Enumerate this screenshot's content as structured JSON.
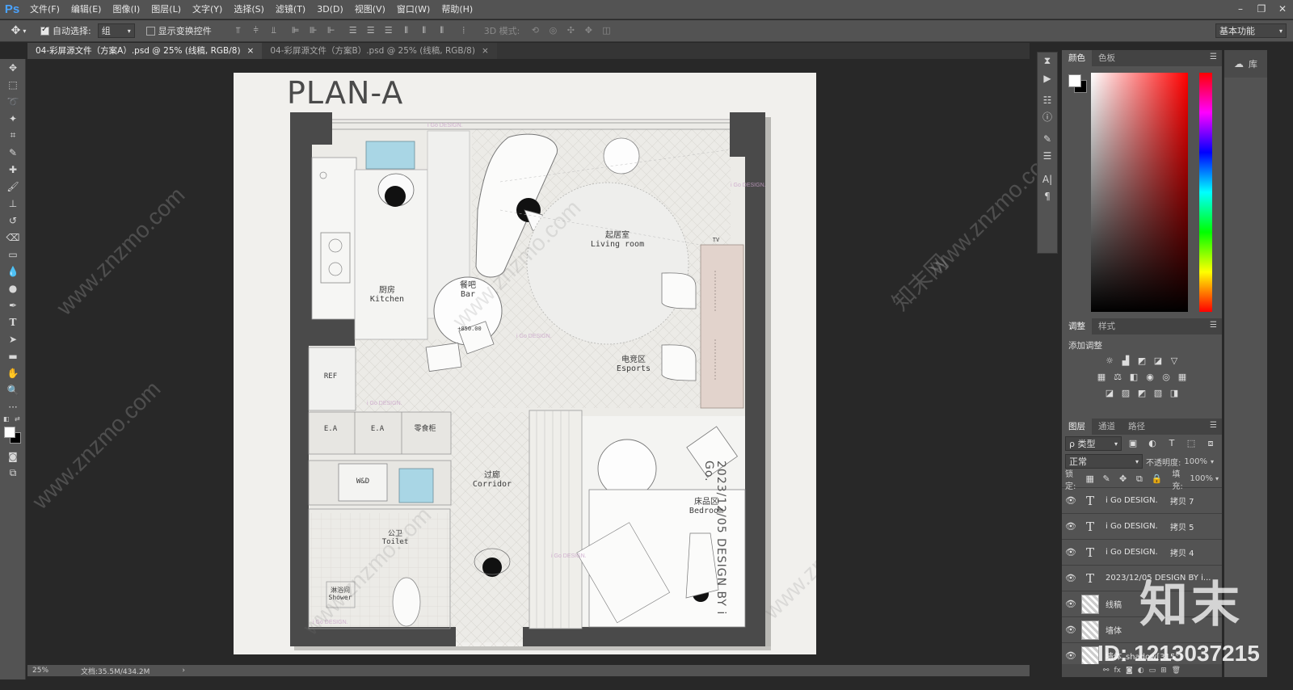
{
  "app": {
    "logo": "Ps"
  },
  "menu": [
    "文件(F)",
    "编辑(E)",
    "图像(I)",
    "图层(L)",
    "文字(Y)",
    "选择(S)",
    "滤镜(T)",
    "3D(D)",
    "视图(V)",
    "窗口(W)",
    "帮助(H)"
  ],
  "window_controls": [
    "–",
    "❐",
    "✕"
  ],
  "options": {
    "auto_select_label": "自动选择:",
    "auto_select_value": "组",
    "show_transform_label": "显示变换控件",
    "mode_3d_label": "3D 模式:",
    "workspace": "基本功能"
  },
  "tabs": [
    {
      "label": "04-彩屏源文件（方案A）.psd @ 25% (线稿, RGB/8)",
      "close": "×"
    },
    {
      "label": "04-彩屏源文件（方案B）.psd @ 25% (线稿, RGB/8)",
      "close": "×"
    }
  ],
  "status": {
    "zoom": "25%",
    "doc": "文档:35.5M/434.2M",
    "arrow": "›"
  },
  "plan": {
    "title": "PLAN-A",
    "date": "2023/12/05 DESIGN BY i Go.",
    "watermark": "i Go DESIGN.",
    "rooms": {
      "living_cn": "起居室",
      "living_en": "Living room",
      "kitchen_cn": "厨房",
      "kitchen_en": "Kitchen",
      "bar_cn": "餐吧",
      "bar_en": "Bar",
      "bar_height": "+850.00",
      "esports_cn": "电竞区",
      "esports_en": "Esports",
      "tv": "TV",
      "ref": "REF",
      "ea1": "E.A",
      "ea2": "E.A",
      "snack": "零食柜",
      "wd": "W&D",
      "corridor_cn": "过廊",
      "corridor_en": "Corridor",
      "toilet_cn": "公卫",
      "toilet_en": "Toilet",
      "shower_cn": "淋浴间",
      "shower_en": "Shower",
      "bedroom_cn": "床品区",
      "bedroom_en": "Bedroom"
    }
  },
  "overlay": {
    "site_watermark": "www.znzmo.com",
    "brand": "知末",
    "id": "ID: 1213037215",
    "brand_small": "知末网"
  },
  "color_panel": {
    "tabs": [
      "颜色",
      "色板"
    ]
  },
  "adjust_panel": {
    "tabs": [
      "调整",
      "样式"
    ],
    "add_label": "添加调整"
  },
  "layers_panel": {
    "tabs": [
      "图层",
      "通道",
      "路径"
    ],
    "filter": "ρ 类型",
    "blend": "正常",
    "opacity_label": "不透明度:",
    "opacity": "100%",
    "lock_label": "锁定:",
    "fill_label": "填充:",
    "fill": "100%",
    "layers": [
      {
        "type": "text",
        "name": "i Go DESIGN.",
        "suffix": "拷贝 7"
      },
      {
        "type": "text",
        "name": "i Go DESIGN.",
        "suffix": "拷贝 5"
      },
      {
        "type": "text",
        "name": "i Go DESIGN.",
        "suffix": "拷贝 4"
      },
      {
        "type": "text",
        "name": "2023/12/05 DESIGN BY i...",
        "suffix": ""
      },
      {
        "type": "image",
        "name": "线稿",
        "suffix": ""
      },
      {
        "type": "image",
        "name": "墙体",
        "suffix": ""
      },
      {
        "type": "image",
        "name": "墙体_shadow[315°]",
        "suffix": ""
      }
    ]
  },
  "library": {
    "label": "库"
  },
  "colors": {
    "ps_blue": "#4aa3ff",
    "wall": "#4a4a4a",
    "glass": "#a9d6e5",
    "tv_wood": "#e2d3cc"
  }
}
